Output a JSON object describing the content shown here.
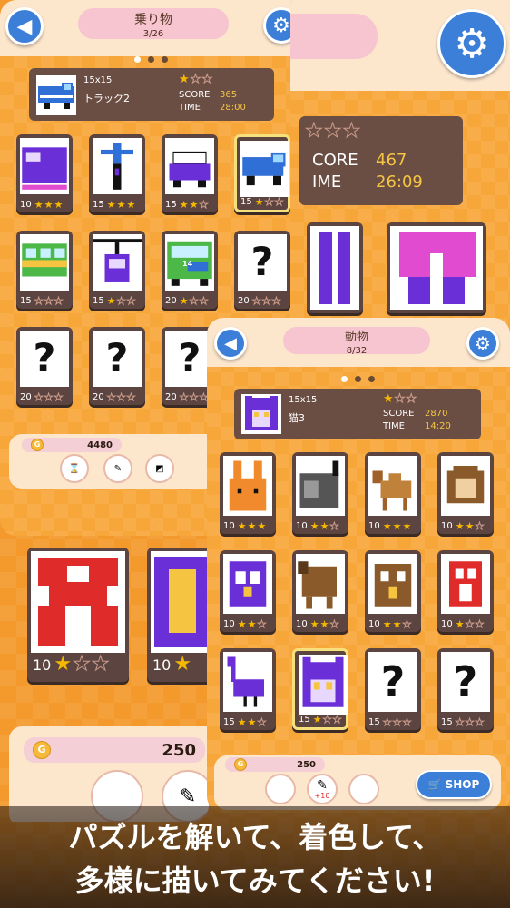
{
  "back_panel": {
    "category": "乗り物",
    "progress": "3/26",
    "selected": {
      "size": "15x15",
      "name": "トラック2",
      "score_label": "SCORE",
      "score": "365",
      "time_label": "TIME",
      "time": "28:00",
      "stars": 1
    },
    "cards": [
      {
        "size": "10",
        "stars": 3,
        "kind": "train-purple"
      },
      {
        "size": "15",
        "stars": 3,
        "kind": "bike"
      },
      {
        "size": "15",
        "stars": 2,
        "kind": "car"
      },
      {
        "size": "15",
        "stars": 1,
        "kind": "truck",
        "selected": true
      },
      {
        "size": "15",
        "stars": 0,
        "kind": "tram"
      },
      {
        "size": "15",
        "stars": 1,
        "kind": "ropeway"
      },
      {
        "size": "20",
        "stars": 1,
        "kind": "bus",
        "label": "14"
      },
      {
        "size": "20",
        "stars": 0,
        "kind": "unknown",
        "q": "?"
      },
      {
        "size": "20",
        "stars": 0,
        "kind": "unknown",
        "q": "?"
      },
      {
        "size": "20",
        "stars": 0,
        "kind": "unknown",
        "q": "?"
      },
      {
        "size": "20",
        "stars": 0,
        "kind": "unknown",
        "q": "?"
      }
    ],
    "gold": "4480"
  },
  "mid_panel": {
    "score_label": "CORE",
    "score": "467",
    "time_label": "IME",
    "time": "26:09"
  },
  "left_bottom": {
    "size1": "10",
    "size2": "10",
    "gold": "250"
  },
  "front_panel": {
    "category": "動物",
    "progress": "8/32",
    "selected": {
      "size": "15x15",
      "name": "猫3",
      "score_label": "SCORE",
      "score": "2870",
      "time_label": "TIME",
      "time": "14:20",
      "stars": 1
    },
    "cards": [
      {
        "size": "10",
        "stars": 3,
        "kind": "rabbit"
      },
      {
        "size": "10",
        "stars": 2,
        "kind": "rhino"
      },
      {
        "size": "10",
        "stars": 3,
        "kind": "camel"
      },
      {
        "size": "10",
        "stars": 2,
        "kind": "cow"
      },
      {
        "size": "10",
        "stars": 2,
        "kind": "owl"
      },
      {
        "size": "10",
        "stars": 2,
        "kind": "dog"
      },
      {
        "size": "10",
        "stars": 2,
        "kind": "eagle"
      },
      {
        "size": "10",
        "stars": 1,
        "kind": "bird"
      },
      {
        "size": "15",
        "stars": 2,
        "kind": "ostrich"
      },
      {
        "size": "15",
        "stars": 1,
        "kind": "cat",
        "selected": true
      },
      {
        "size": "15",
        "stars": 0,
        "kind": "unknown",
        "q": "?"
      },
      {
        "size": "15",
        "stars": 0,
        "kind": "unknown",
        "q": "?"
      }
    ],
    "gold": "250",
    "shop": "SHOP",
    "item_badge": "+10"
  },
  "caption": {
    "line1": "パズルを解いて、着色して、",
    "line2": "多様に描いてみてください!"
  },
  "colors": {
    "accent": "#3b7fd9",
    "header": "#fce6cc",
    "pill": "#f6c5cf",
    "card": "#5c4540",
    "star": "#f5b800",
    "panel": "#f7a63a"
  }
}
